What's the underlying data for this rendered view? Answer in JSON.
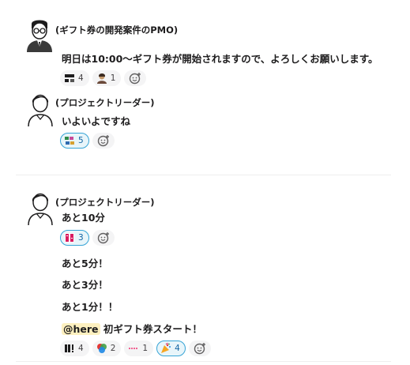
{
  "messages": {
    "m1": {
      "author": "(ギフト券の開発案件のPMO)",
      "text": "明日は10:00〜ギフト券が開始されますので、よろしくお願いします。",
      "reactions": [
        {
          "emoji": "reaction-emoji-text",
          "count": "4"
        },
        {
          "emoji": "reaction-emoji-person",
          "count": "1"
        }
      ]
    },
    "m2": {
      "author": "(プロジェクトリーダー)",
      "text": "いよいよですね",
      "reactions": [
        {
          "emoji": "reaction-emoji-sparkle-text",
          "count": "5",
          "active": true
        }
      ]
    },
    "m3": {
      "author": "(プロジェクトリーダー)",
      "text": "あと10分",
      "reactions": [
        {
          "emoji": "reaction-emoji-dokidoki",
          "count": "3",
          "active": true
        }
      ]
    },
    "m4": {
      "text": "あと5分！"
    },
    "m5": {
      "text": "あと3分！"
    },
    "m6": {
      "text": "あと1分！！"
    },
    "m7": {
      "mention": "@here",
      "text": " 初ギフト券スタート！",
      "reactions": [
        {
          "emoji": "reaction-emoji-black-text",
          "count": "4"
        },
        {
          "emoji": "reaction-emoji-rainbow-blob",
          "count": "2"
        },
        {
          "emoji": "reaction-emoji-pink-dots",
          "count": "1"
        },
        {
          "emoji": "reaction-emoji-party-popper",
          "count": "4",
          "active": true
        }
      ]
    }
  },
  "colors": {
    "active_border": "#36a4d6",
    "active_bg": "#e8f5fa",
    "pill_bg": "#f4f4f5",
    "mention_bg": "#fdf0bf"
  }
}
